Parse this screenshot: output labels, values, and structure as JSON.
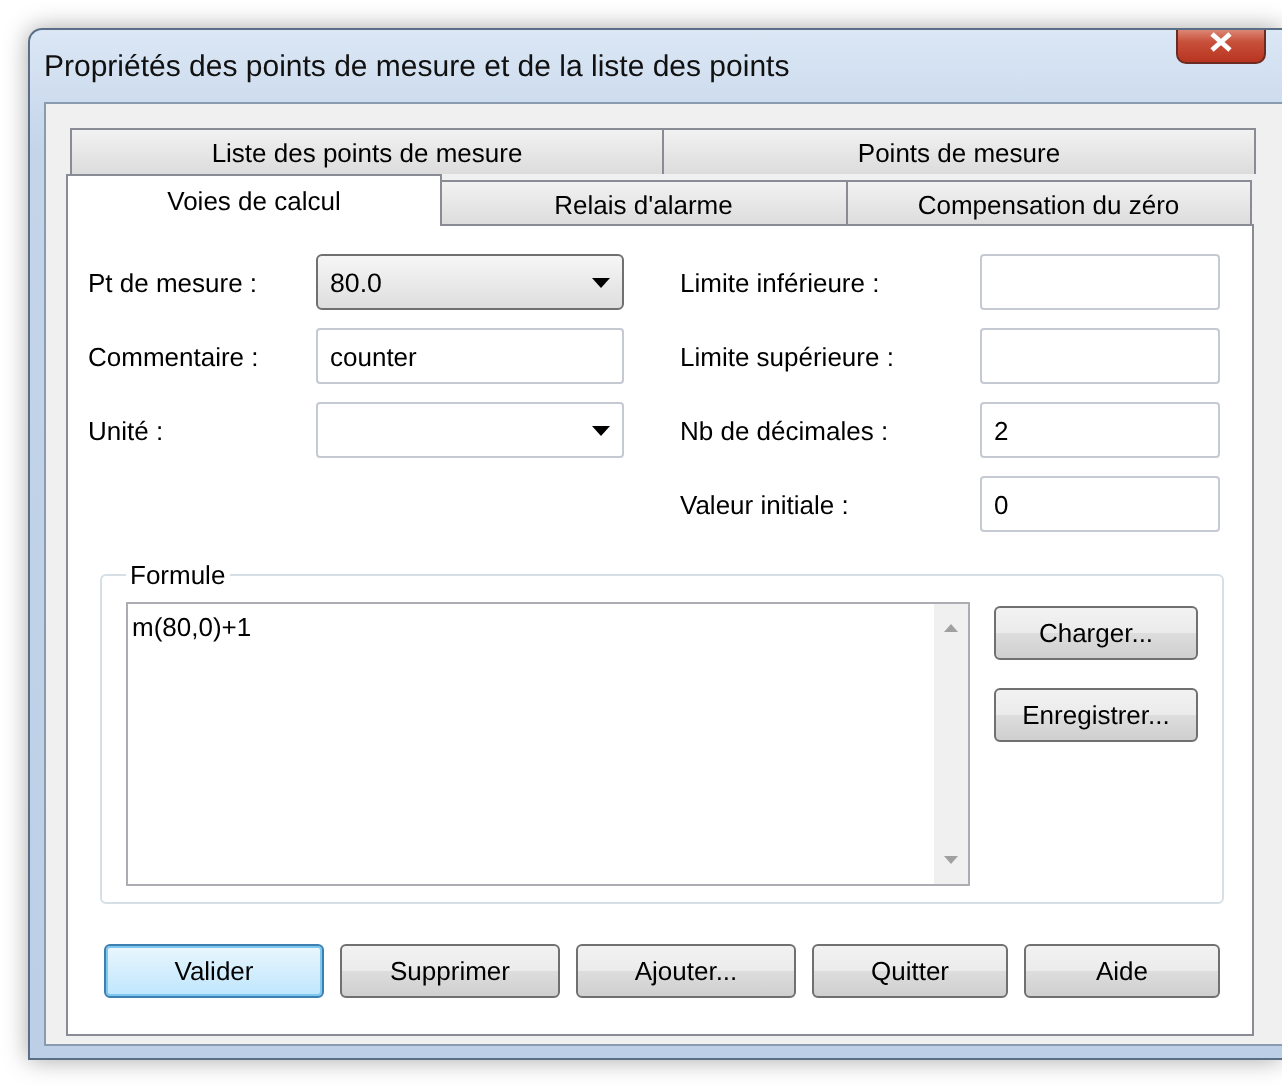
{
  "window": {
    "title": "Propriétés des points de mesure et de la liste des points"
  },
  "tab_rows": [
    {
      "tabs": [
        {
          "label": "Liste des points de mesure",
          "selected": false
        },
        {
          "label": "Points de mesure",
          "selected": false
        }
      ]
    },
    {
      "tabs": [
        {
          "label": "Voies de calcul",
          "selected": true
        },
        {
          "label": "Relais d'alarme",
          "selected": false
        },
        {
          "label": "Compensation du zéro",
          "selected": false
        }
      ]
    }
  ],
  "left_fields": [
    {
      "label": "Pt de mesure :",
      "kind": "list",
      "value": "80.0"
    },
    {
      "label": "Commentaire :",
      "kind": "text",
      "value": "counter"
    },
    {
      "label": "Unité :",
      "kind": "combo"
    }
  ],
  "right_fields": [
    {
      "label": "Limite inférieure :",
      "kind": "text"
    },
    {
      "label": "Limite supérieure :",
      "kind": "text"
    },
    {
      "label": "Nb de décimales :",
      "kind": "text",
      "value": "2"
    },
    {
      "label": "Valeur initiale :",
      "kind": "text",
      "value": "0"
    }
  ],
  "formula": {
    "title": "Formule",
    "value": "m(80,0)+1",
    "buttons": [
      "Charger...",
      "Enregistrer..."
    ]
  },
  "buttons": [
    {
      "label": "Valider",
      "default": true
    },
    {
      "label": "Supprimer",
      "default": false
    },
    {
      "label": "Ajouter...",
      "default": false
    },
    {
      "label": "Quitter",
      "default": false
    },
    {
      "label": "Aide",
      "default": false
    }
  ]
}
